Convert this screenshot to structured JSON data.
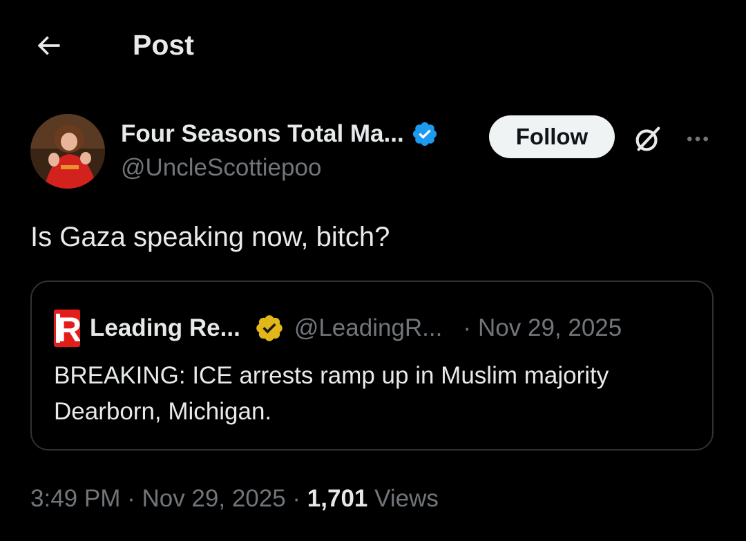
{
  "header": {
    "title": "Post",
    "back_icon": "arrow-left-icon"
  },
  "author": {
    "display_name": "Four Seasons Total Ma...",
    "handle": "@UncleScottiepoo",
    "verified_badge": "verified-blue-icon",
    "follow_label": "Follow",
    "grok_icon": "grok-icon",
    "more_icon": "more-icon"
  },
  "post": {
    "text": "Is Gaza speaking now, bitch?"
  },
  "quote": {
    "display_name": "Leading Re...",
    "handle": "@LeadingR...",
    "separator": "·",
    "date": "Nov 29, 2025",
    "verified_badge": "verified-gold-icon",
    "avatar_logo_letter": "R",
    "text": "BREAKING: ICE arrests ramp up in Muslim majority Dearborn, Michigan."
  },
  "meta": {
    "time": "3:49 PM",
    "sep1": " · ",
    "date": "Nov 29, 2025",
    "sep2": " · ",
    "views_count": "1,701",
    "views_label": " Views"
  },
  "colors": {
    "background": "#000000",
    "text_primary": "#e7e9ea",
    "text_secondary": "#71767b",
    "border": "#2f3336",
    "verified_blue": "#1d9bf0",
    "verified_gold": "#e2b719",
    "follow_bg": "#eff3f4",
    "brand_red": "#e31d1a"
  }
}
